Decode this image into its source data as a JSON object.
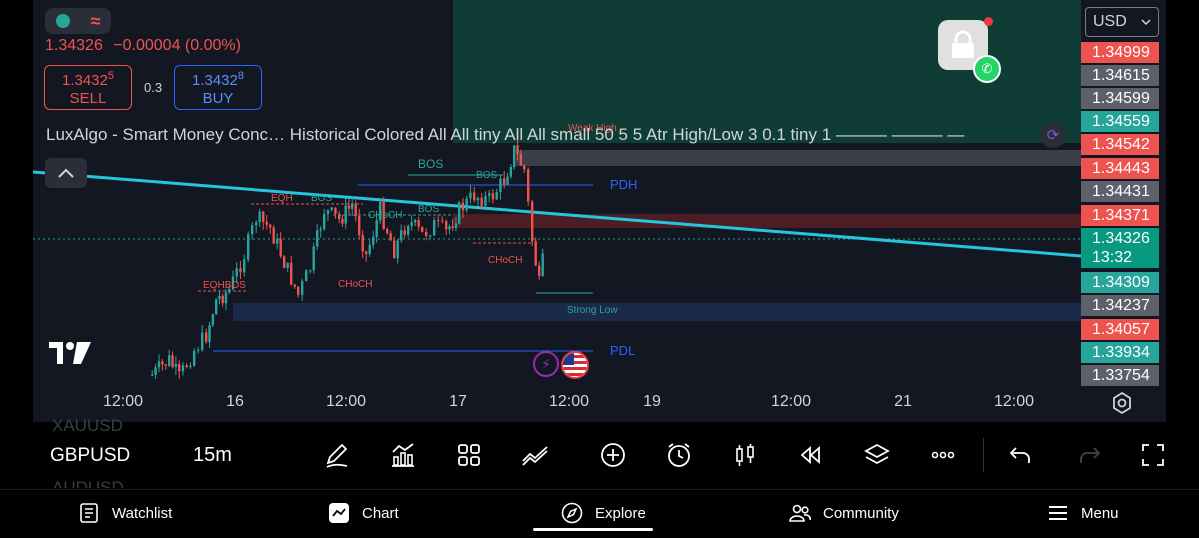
{
  "header": {
    "price": "1.34326",
    "change": "−0.00004 (0.00%)"
  },
  "trade": {
    "sell_price_main": "1.3432",
    "sell_price_sup": "5",
    "sell_label": "SELL",
    "spread": "0.3",
    "buy_price_main": "1.3432",
    "buy_price_sup": "8",
    "buy_label": "BUY"
  },
  "indicator": {
    "text": "LuxAlgo - Smart Money Conc…  Historical Colored All All tiny All All small 50 5 5 Atr High/Low 3 0.1 tiny 1  ———  ———  —"
  },
  "chart_labels": {
    "bos_top": "BOS",
    "bos_2": "BOS",
    "bos_3": "BOS",
    "bos_4": "BOS",
    "bos_5": "BOS",
    "eqh": "EQH",
    "eqh_bos": "EQHBOS",
    "choch_1": "CHoCH",
    "choch_2": "CHoCH",
    "choch_3": "CHoCH",
    "pdh": "PDH",
    "pdl": "PDL",
    "strong_low": "Strong Low",
    "weak_high": "Weak High"
  },
  "price_scale": {
    "currency": "USD",
    "tags": [
      {
        "value": "1.34999",
        "color": "red"
      },
      {
        "value": "1.34615",
        "color": "gray"
      },
      {
        "value": "1.34599",
        "color": "gray"
      },
      {
        "value": "1.34559",
        "color": "green"
      },
      {
        "value": "1.34542",
        "color": "red"
      },
      {
        "value": "1.34443",
        "color": "red"
      },
      {
        "value": "1.34431",
        "color": "gray"
      },
      {
        "value": "1.34371",
        "color": "red"
      },
      {
        "value": "1.34326",
        "color": "current",
        "countdown": "13:32"
      },
      {
        "value": "1.34309",
        "color": "green"
      },
      {
        "value": "1.34237",
        "color": "gray"
      },
      {
        "value": "1.34057",
        "color": "red"
      },
      {
        "value": "1.33934",
        "color": "green"
      },
      {
        "value": "1.33754",
        "color": "gray"
      }
    ]
  },
  "time_axis": [
    "12:00",
    "16",
    "12:00",
    "17",
    "12:00",
    "19",
    "12:00",
    "21",
    "12:00"
  ],
  "toolbar": {
    "symbol_prev": "XAUUSD",
    "symbol": "GBPUSD",
    "symbol_next": "AUDUSD",
    "interval": "15m"
  },
  "nav": {
    "watchlist": "Watchlist",
    "chart": "Chart",
    "explore": "Explore",
    "community": "Community",
    "menu": "Menu"
  },
  "colors": {
    "bull": "#26a69a",
    "bear": "#ef5350",
    "trendline": "#26c6da",
    "background": "#131722"
  }
}
